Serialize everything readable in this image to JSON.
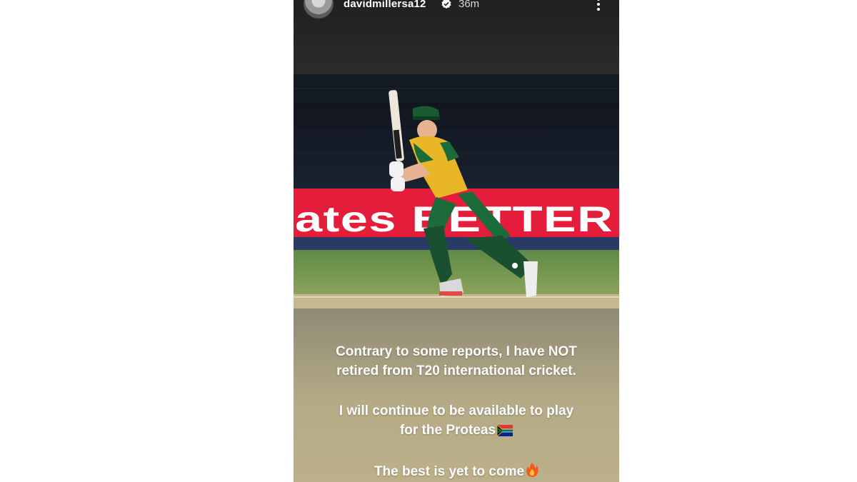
{
  "story": {
    "username": "davidmillersa12",
    "verified_icon": "verified-badge-icon",
    "time_ago": "36m",
    "more_icon": "more-vertical-icon"
  },
  "photo": {
    "banner_text": "ates BETTER"
  },
  "caption": {
    "line1": "Contrary to some reports, I have NOT",
    "line2": "retired from T20 international cricket.",
    "line3": "I will continue to be available to play",
    "line4": "for the Proteas",
    "line4_emoji": "south-africa-flag-icon",
    "line5": "The best is yet to come",
    "line5_emoji": "fire-icon"
  },
  "colors": {
    "banner_red": "#e31d3a",
    "jersey_green": "#1c6b3a",
    "jersey_yellow": "#e9b627",
    "caption_bg": "#b5ab86"
  }
}
